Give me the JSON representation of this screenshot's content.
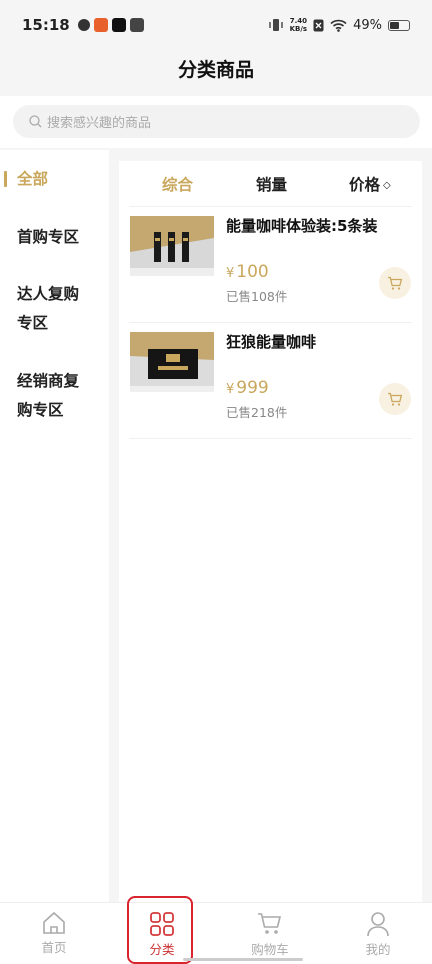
{
  "status_bar": {
    "time": "15:18",
    "net_speed_top": "7.40",
    "net_speed_bottom": "KB/s",
    "battery": "49%"
  },
  "header": {
    "title": "分类商品"
  },
  "search": {
    "placeholder": "搜索感兴趣的商品"
  },
  "sidebar": {
    "items": [
      {
        "label": "全部"
      },
      {
        "label": "首购专区"
      },
      {
        "label": "达人复购"
      },
      {
        "label": "专区"
      },
      {
        "label": "经销商复"
      },
      {
        "label": "购专区"
      }
    ]
  },
  "sort": {
    "comprehensive": "综合",
    "sales": "销量",
    "price": "价格",
    "price_arrow": "◇"
  },
  "products": [
    {
      "title": "能量咖啡体验装:5条装",
      "yen": "¥",
      "price": "100",
      "sold": "已售108件"
    },
    {
      "title": "狂狼能量咖啡",
      "yen": "¥",
      "price": "999",
      "sold": "已售218件"
    }
  ],
  "tabbar": {
    "home": "首页",
    "category": "分类",
    "cart": "购物车",
    "mine": "我的"
  },
  "colors": {
    "accent": "#c9a75c",
    "highlight": "#d9232d"
  }
}
